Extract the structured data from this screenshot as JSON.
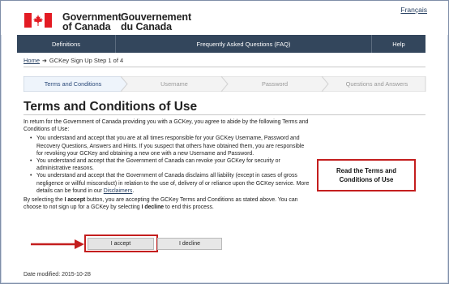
{
  "header": {
    "wordmark_en_line1": "Government",
    "wordmark_en_line2": "of Canada",
    "wordmark_fr_line1": "Gouvernement",
    "wordmark_fr_line2": "du Canada",
    "language_link": "Français"
  },
  "nav": {
    "items": [
      {
        "label": "Definitions"
      },
      {
        "label": "Frequently Asked Questions (FAQ)"
      },
      {
        "label": "Help"
      }
    ]
  },
  "breadcrumb": {
    "home": "Home",
    "current": "GCKey Sign Up Step 1 of 4"
  },
  "steps": [
    {
      "label": "Terms and Conditions",
      "active": true
    },
    {
      "label": "Username",
      "active": false
    },
    {
      "label": "Password",
      "active": false
    },
    {
      "label": "Questions and Answers",
      "active": false
    }
  ],
  "page_title": "Terms and Conditions of Use",
  "content": {
    "intro": "In return for the Government of Canada providing you with a GCKey, you agree to abide by the following Terms and Conditions of Use:",
    "bullets": [
      "You understand and accept that you are at all times responsible for your GCKey Username, Password and Recovery Questions, Answers and Hints. If you suspect that others have obtained them, you are responsible for revoking your GCKey and obtaining a new one with a new Username and Password.",
      "You understand and accept that the Government of Canada can revoke your GCKey for security or administrative reasons."
    ],
    "bullet3_text": "You understand and accept that the Government of Canada disclaims all liability (except in cases of gross negligence or willful misconduct) in relation to the use of, delivery of or reliance upon the GCKey service. More details can be found in our ",
    "bullet3_link": "Disclaimers",
    "bullet3_end": ".",
    "consent_pre": "By selecting the ",
    "consent_accept": "I accept",
    "consent_mid": " button, you are accepting the GCKey Terms and Conditions as stated above. You can choose to not sign up for a GCKey by selecting ",
    "consent_decline": "I decline",
    "consent_end": " to end this process."
  },
  "buttons": {
    "accept": "I accept",
    "decline": "I decline"
  },
  "annotation": "Read the Terms and Conditions of Use",
  "date_modified": "Date modified: 2015-10-28",
  "colors": {
    "flag_red": "#e31b23",
    "nav_bg": "#33465c",
    "callout_red": "#c41e1e",
    "link": "#284162"
  }
}
